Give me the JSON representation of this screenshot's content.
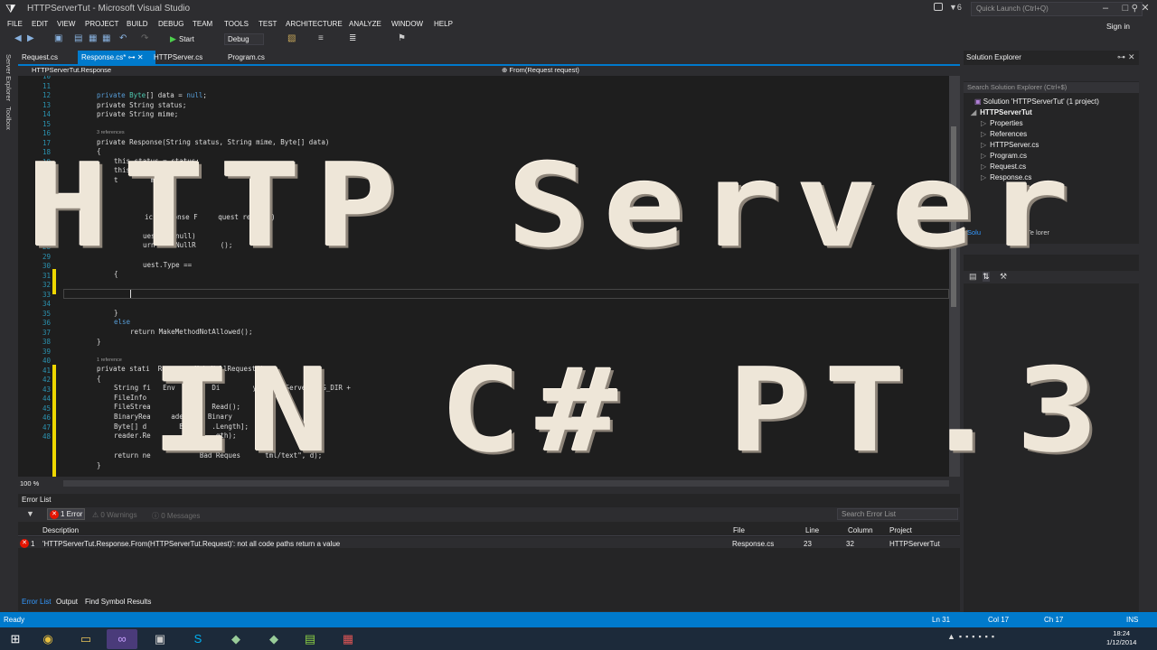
{
  "window": {
    "title": "HTTPServerTut - Microsoft Visual Studio",
    "quick_launch_placeholder": "Quick Launch (Ctrl+Q)",
    "feedback_count": "6",
    "sign_in": "Sign in"
  },
  "menu": [
    "FILE",
    "EDIT",
    "VIEW",
    "PROJECT",
    "BUILD",
    "DEBUG",
    "TEAM",
    "TOOLS",
    "TEST",
    "ARCHITECTURE",
    "ANALYZE",
    "WINDOW",
    "HELP"
  ],
  "toolbar": {
    "start_label": "Start",
    "config": "Debug"
  },
  "left_rail": [
    "Server Explorer",
    "Toolbox"
  ],
  "doc_tabs": [
    {
      "label": "Request.cs"
    },
    {
      "label": "Response.cs*"
    },
    {
      "label": "HTTPServer.cs"
    },
    {
      "label": "Program.cs"
    }
  ],
  "nav": {
    "type": "HTTPServerTut.Response",
    "member": "From(Request request)"
  },
  "code": {
    "line_numbers": [
      "10",
      "11",
      "12",
      "13",
      "14",
      "15",
      "16",
      "17",
      "18",
      "19",
      "20",
      "21",
      "22",
      "23",
      "24",
      "25",
      "26",
      "27",
      "28",
      "29",
      "30",
      "31",
      "32",
      "33",
      "34",
      "35",
      "36",
      "37",
      "38",
      "39",
      "40",
      "41",
      "42",
      "43",
      "44",
      "45",
      "46",
      "47",
      "48"
    ],
    "l11": "private Byte[] data = null;",
    "l12": "private String status;",
    "l13": "private String mime;",
    "refs1": "3 references",
    "l16": "private Response(String status, String mime, Byte[] data)",
    "l17": "{",
    "l18": "this.status = status;",
    "l19": "this.data = d",
    "l20": "t        me",
    "l21": "}",
    "l23": "ic Response F     quest request)",
    "l25": "uest == null)",
    "l26": "urn MakeNullR      ();",
    "l28": "uest.Type ==",
    "l29": "{",
    "l33": "}",
    "l34": "else",
    "l35": "return MakeMethodNotAllowed();",
    "l36": "}",
    "refs2": "1 reference",
    "l38": "private stati  Respon   MakeNullRequest()",
    "l39": "{",
    "l40": "String fi   Env         Di        y + HTTPServer.MSG_DIR +",
    "l41": "FileInfo",
    "l42": "FileStrea         f     Read();",
    "l43": "BinaryRea     ader   w Binary      );",
    "l44": "Byte[] d        Byt     .Length];",
    "l45": "reader.Re         ,      gth);",
    "l47": "return ne            Bad Reques      tml/text\", d);",
    "l48": "}"
  },
  "zoom": "100 %",
  "error_list": {
    "title": "Error List",
    "errors_btn": "1 Error",
    "warnings_btn": "0 Warnings",
    "messages_btn": "0 Messages",
    "search_placeholder": "Search Error List",
    "columns": [
      "Description",
      "File",
      "Line",
      "Column",
      "Project"
    ],
    "rows": [
      {
        "num": "1",
        "description": "'HTTPServerTut.Response.From(HTTPServerTut.Request)': not all code paths return a value",
        "file": "Response.cs",
        "line": "23",
        "column": "32",
        "project": "HTTPServerTut"
      }
    ]
  },
  "bottom_tabs": [
    "Error List",
    "Output",
    "Find Symbol Results"
  ],
  "solution_explorer": {
    "title": "Solution Explorer",
    "search_placeholder": "Search Solution Explorer (Ctrl+$)",
    "solution": "Solution 'HTTPServerTut' (1 project)",
    "project": "HTTPServerTut",
    "items": [
      "Properties",
      "References",
      "HTTPServer.cs",
      "Program.cs",
      "Request.cs",
      "Response.cs"
    ],
    "bottom_tabs": [
      "Solu",
      "Te   lorer"
    ]
  },
  "status": {
    "ready": "Ready",
    "ln": "Ln 31",
    "col": "Col 17",
    "ch": "Ch 17",
    "ins": "INS"
  },
  "clock": {
    "time": "18:24",
    "date": "1/12/2014"
  },
  "overlay": {
    "line1": "HTTP Server",
    "line2": "IN C# PT.3"
  }
}
